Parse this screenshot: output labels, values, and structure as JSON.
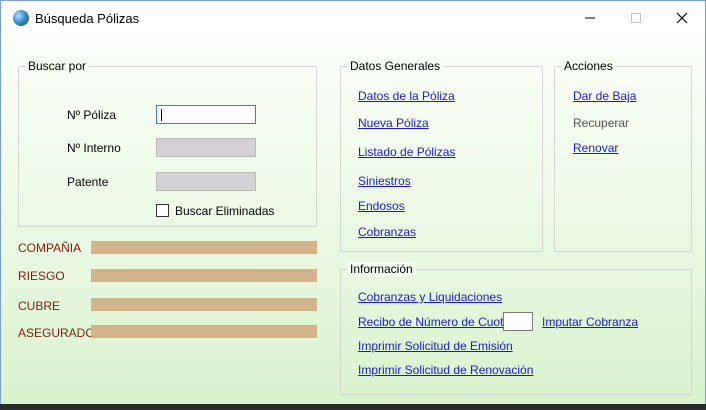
{
  "window": {
    "title": "Búsqueda Pólizas"
  },
  "buscar_por": {
    "legend": "Buscar por",
    "poliza_label": "Nº Póliza",
    "interno_label": "Nº Interno",
    "patente_label": "Patente",
    "poliza_value": "",
    "interno_value": "",
    "patente_value": "",
    "eliminadas_label": "Buscar Eliminadas",
    "eliminadas_checked": false
  },
  "details": {
    "compania": "COMPAÑIA",
    "riesgo": "RIESGO",
    "cubre": "CUBRE",
    "asegurado": "ASEGURADO"
  },
  "datos_generales": {
    "legend": "Datos Generales",
    "items": [
      "Datos de la Póliza",
      "Nueva Póliza",
      "Listado de Pólizas",
      "Siniestros",
      "Endosos",
      "Cobranzas"
    ]
  },
  "acciones": {
    "legend": "Acciones",
    "dar_de_baja": "Dar de Baja",
    "recuperar": "Recuperar",
    "renovar": "Renovar"
  },
  "informacion": {
    "legend": "Información",
    "cobranzas_liquidaciones": "Cobranzas y Liquidaciones",
    "recibo_label": "Recibo de Número de Cuota:",
    "cuota_value": "",
    "imputar": "Imputar Cobranza",
    "imprimir_emision": "Imprimir Solicitud de Emisión",
    "imprimir_renovacion": "Imprimir Solicitud de Renovación"
  },
  "colors": {
    "link": "#1b1bc4",
    "label_red": "#7a1c10",
    "bar_tan": "#d2b48c"
  }
}
